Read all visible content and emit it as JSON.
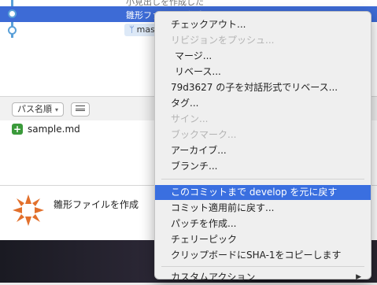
{
  "graph": {
    "top_commit_message": "小見出しを作成した",
    "selected_commit_message": "雛形ファイルを作成",
    "branch_tag": "mas"
  },
  "file_list": {
    "sort_label": "パス名順",
    "files": [
      {
        "status": "+",
        "name": "sample.md"
      }
    ]
  },
  "commit_detail": {
    "message": "雛形ファイルを作成"
  },
  "context_menu": {
    "items": [
      {
        "label": "チェックアウト...",
        "disabled": false
      },
      {
        "label": "リビジョンをプッシュ...",
        "disabled": true
      },
      {
        "label": "マージ...",
        "disabled": false
      },
      {
        "label": "リベース...",
        "disabled": false
      },
      {
        "label": "79d3627 の子を対話形式でリベース...",
        "disabled": false
      },
      {
        "label": "タグ...",
        "disabled": false
      },
      {
        "label": "サイン...",
        "disabled": true
      },
      {
        "label": "ブックマーク...",
        "disabled": true
      },
      {
        "label": "アーカイブ...",
        "disabled": false
      },
      {
        "label": "ブランチ...",
        "disabled": false
      },
      {
        "label": "このコミットまで develop を元に戻す",
        "disabled": false,
        "highlighted": true
      },
      {
        "label": "コミット適用前に戻す...",
        "disabled": false
      },
      {
        "label": "パッチを作成...",
        "disabled": false
      },
      {
        "label": "チェリーピック",
        "disabled": false
      },
      {
        "label": "クリップボードにSHA-1をコピーします",
        "disabled": false
      },
      {
        "label": "カスタムアクション",
        "disabled": false,
        "submenu": true
      }
    ]
  },
  "colors": {
    "selection": "#3d6bd6",
    "menu_highlight": "#3a6fe0",
    "added_status": "#3a9a3a",
    "graph_line": "#5aa0d8"
  }
}
